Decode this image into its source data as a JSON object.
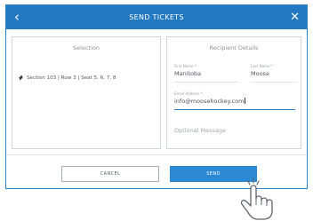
{
  "header": {
    "title": "SEND TICKETS",
    "back_icon": "‹",
    "close_icon": "✕",
    "background": "#2279c0"
  },
  "selection": {
    "heading": "Selection",
    "seat_text": "Section 103 | Row 3 | Seat 5, 6, 7, 8"
  },
  "recipient": {
    "heading": "Recipient Details",
    "first_name": {
      "label": "First Name *",
      "value": "Manitoba"
    },
    "last_name": {
      "label": "Last Name *",
      "value": "Moose"
    },
    "email": {
      "label": "Email Address *",
      "value": "info@moosehockey.com"
    },
    "optional_message_placeholder": "Optional Message"
  },
  "actions": {
    "cancel_label": "CANCEL",
    "send_label": "SEND",
    "send_color": "#2c89d3"
  },
  "icons": {
    "ticket": "ticket-icon",
    "cursor": "hand-pointer-icon"
  }
}
